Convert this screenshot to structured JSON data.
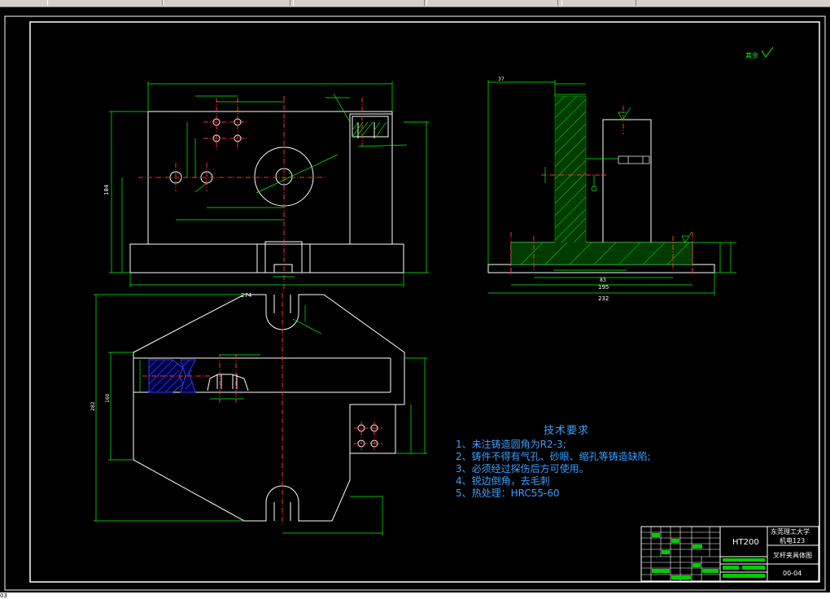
{
  "drawing": {
    "roughness_note": "其余",
    "tech_requirements": {
      "title": "技术要求",
      "items": [
        "1、未注铸造圆角为R2-3;",
        "2、铸件不得有气孔、砂眼、缩孔等铸造缺陷;",
        "3、必须经过探伤后方可使用。",
        "4、锐边倒角，去毛刺",
        "5、热处理：HRC55-60"
      ]
    },
    "title_block": {
      "material": "HT200",
      "school": "东莞理工大学",
      "class": "机电123",
      "part_name": "叉杆夹具体图",
      "drawing_no": "00-04"
    },
    "front_view_dims": {
      "overall_width": "274",
      "height": "184"
    },
    "side_view_dims": {
      "top_width": "37",
      "overall": "232",
      "mid": "195",
      "lower": "83"
    },
    "bottom_label": "03"
  },
  "colors": {
    "background": "#000000",
    "outline": "#ffffff",
    "dimension": "#00ff00",
    "centerline": "#ff3030",
    "hatch": "#00cc00",
    "text_blue": "#3aa0ff",
    "frame": "#ffffff"
  }
}
